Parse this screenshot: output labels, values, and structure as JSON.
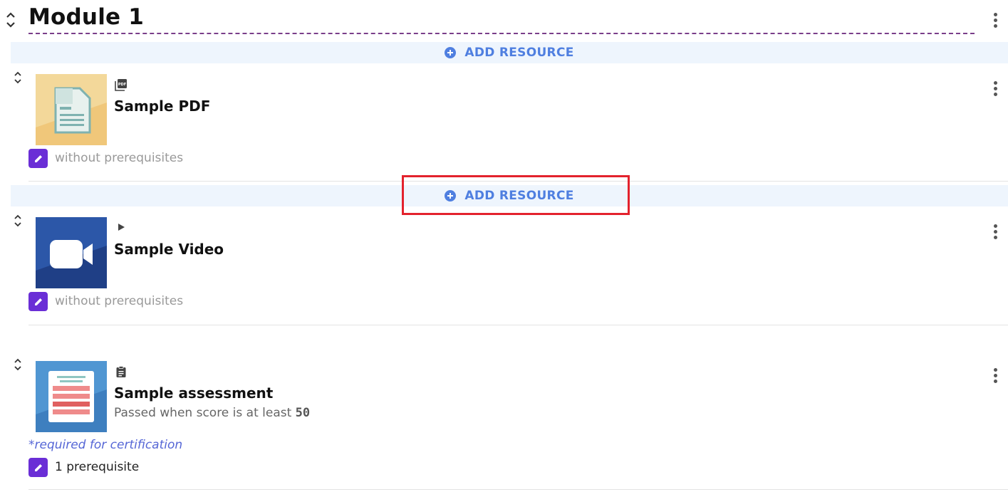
{
  "module": {
    "title": "Module 1"
  },
  "add_resource": {
    "label": "ADD RESOURCE"
  },
  "resources": [
    {
      "type_icon": "pdf-icon",
      "title": "Sample PDF",
      "subtitle": "",
      "prerequisites": "without prerequisites"
    },
    {
      "type_icon": "play-icon",
      "title": "Sample Video",
      "subtitle": "",
      "prerequisites": "without prerequisites"
    },
    {
      "type_icon": "clipboard-icon",
      "title": "Sample assessment",
      "subtitle_prefix": "Passed when score is at least",
      "passing_score": "50",
      "certification_note": "*required for certification",
      "prerequisites": "1 prerequisite"
    }
  ],
  "colors": {
    "accent": "#4f7fe0",
    "edit_button": "#6a2ed6",
    "highlight": "#e3222d",
    "module_underline": "#7a3e8a"
  }
}
